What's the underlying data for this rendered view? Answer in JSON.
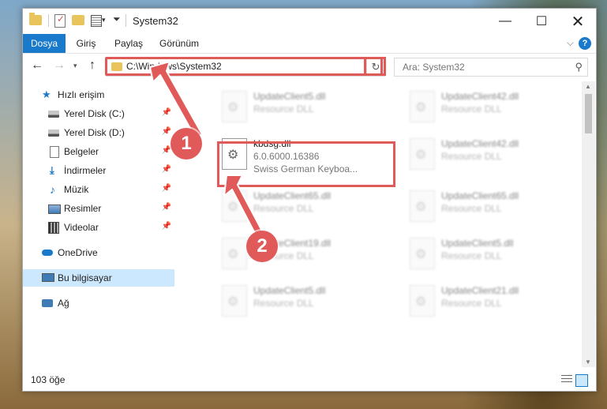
{
  "window": {
    "title": "System32"
  },
  "ribbon": {
    "tabs": [
      "Dosya",
      "Giriş",
      "Paylaş",
      "Görünüm"
    ]
  },
  "nav": {
    "address": "C:\\Windows\\System32",
    "search_placeholder": "Ara: System32"
  },
  "sidebar": {
    "items": [
      {
        "label": "Hızlı erişim",
        "icon": "star-icon"
      },
      {
        "label": "Yerel Disk (C:)",
        "icon": "drive-icon",
        "pinned": true
      },
      {
        "label": "Yerel Disk (D:)",
        "icon": "drive-icon",
        "pinned": true
      },
      {
        "label": "Belgeler",
        "icon": "documents-icon",
        "pinned": true
      },
      {
        "label": "İndirmeler",
        "icon": "downloads-icon",
        "pinned": true
      },
      {
        "label": "Müzik",
        "icon": "music-icon",
        "pinned": true
      },
      {
        "label": "Resimler",
        "icon": "pictures-icon",
        "pinned": true
      },
      {
        "label": "Videolar",
        "icon": "videos-icon",
        "pinned": true
      },
      {
        "label": "OneDrive",
        "icon": "onedrive-icon"
      },
      {
        "label": "Bu bilgisayar",
        "icon": "this-pc-icon",
        "selected": true
      },
      {
        "label": "Ağ",
        "icon": "network-icon"
      }
    ]
  },
  "files": {
    "highlighted": {
      "name": "kbdsg.dll",
      "version": "6.0.6000.16386",
      "description": "Swiss German Keyboa..."
    },
    "blurred": [
      {
        "name": "UpdateClient5.dll",
        "type": "Resource DLL"
      },
      {
        "name": "UpdateClient42.dll",
        "type": "Resource DLL"
      },
      {
        "name": "UpdateClient42.dll",
        "type": "Resource DLL"
      },
      {
        "name": "UpdateClient65.dll",
        "type": "Resource DLL"
      },
      {
        "name": "UpdateClient65.dll",
        "type": "Resource DLL"
      },
      {
        "name": "UpdateClient19.dll",
        "type": "Resource DLL"
      },
      {
        "name": "UpdateClient5.dll",
        "type": "Resource DLL"
      },
      {
        "name": "UpdateClient5.dll",
        "type": "Resource DLL"
      },
      {
        "name": "UpdateClient21.dll",
        "type": "Resource DLL"
      }
    ]
  },
  "status": {
    "count": "103 öğe"
  },
  "annotations": {
    "badge1": "1",
    "badge2": "2",
    "accent": "#e15a5a"
  }
}
